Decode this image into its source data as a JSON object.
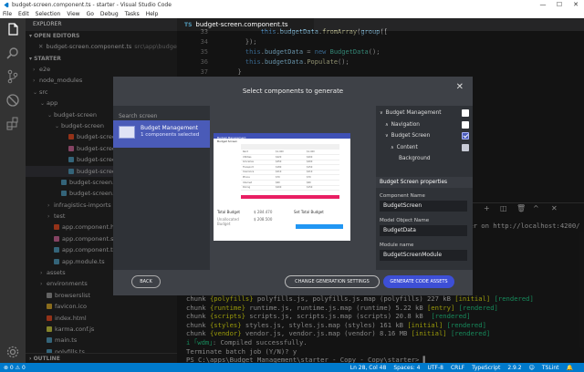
{
  "window": {
    "title": "budget-screen.component.ts - starter - Visual Studio Code",
    "minimize": "—",
    "maximize": "☐",
    "close": "✕"
  },
  "menu": [
    "File",
    "Edit",
    "Selection",
    "View",
    "Go",
    "Debug",
    "Tasks",
    "Help"
  ],
  "sidebar": {
    "header": "EXPLORER",
    "open_editors_title": "OPEN EDITORS",
    "open_editor": {
      "name": "budget-screen.component.ts",
      "path": "src\\app\\budget-sc..."
    },
    "project_title": "STARTER",
    "tree": [
      {
        "label": "e2e",
        "indent": 1,
        "kind": "folder"
      },
      {
        "label": "node_modules",
        "indent": 1,
        "kind": "folder"
      },
      {
        "label": "src",
        "indent": 1,
        "kind": "folder-open"
      },
      {
        "label": "app",
        "indent": 2,
        "kind": "folder-open"
      },
      {
        "label": "budget-screen",
        "indent": 3,
        "kind": "folder-open"
      },
      {
        "label": "budget-screen",
        "indent": 4,
        "kind": "folder-open"
      },
      {
        "label": "budget-screen.com",
        "indent": 5,
        "kind": "html"
      },
      {
        "label": "budget-screen.com",
        "indent": 5,
        "kind": "css"
      },
      {
        "label": "budget-screen.com",
        "indent": 5,
        "kind": "ts"
      },
      {
        "label": "budget-screen.com",
        "indent": 5,
        "kind": "ts",
        "selected": true
      },
      {
        "label": "budget-screen.modul",
        "indent": 4,
        "kind": "ts"
      },
      {
        "label": "budget-screen.modul",
        "indent": 4,
        "kind": "ts"
      },
      {
        "label": "infragistics-imports",
        "indent": 3,
        "kind": "folder"
      },
      {
        "label": "test",
        "indent": 3,
        "kind": "folder"
      },
      {
        "label": "app.component.html",
        "indent": 3,
        "kind": "html"
      },
      {
        "label": "app.component.scss",
        "indent": 3,
        "kind": "css"
      },
      {
        "label": "app.component.ts",
        "indent": 3,
        "kind": "ts"
      },
      {
        "label": "app.module.ts",
        "indent": 3,
        "kind": "ts"
      },
      {
        "label": "assets",
        "indent": 2,
        "kind": "folder"
      },
      {
        "label": "environments",
        "indent": 2,
        "kind": "folder"
      },
      {
        "label": "browserslist",
        "indent": 2,
        "kind": "file"
      },
      {
        "label": "favicon.ico",
        "indent": 2,
        "kind": "ico"
      },
      {
        "label": "index.html",
        "indent": 2,
        "kind": "html"
      },
      {
        "label": "karma.conf.js",
        "indent": 2,
        "kind": "js"
      },
      {
        "label": "main.ts",
        "indent": 2,
        "kind": "ts"
      },
      {
        "label": "polyfills.ts",
        "indent": 2,
        "kind": "ts"
      },
      {
        "label": "styles.scss",
        "indent": 2,
        "kind": "css"
      },
      {
        "label": "test.ts",
        "indent": 2,
        "kind": "ts"
      }
    ],
    "outline": "OUTLINE"
  },
  "editor": {
    "tab_label": "budget-screen.component.ts",
    "tab_badge": "TS",
    "lines": [
      {
        "n": "33",
        "html": "        <span class='k'>this</span>.<span class='p'>budgetData</span>.<span class='f'>fromArray</span>(<span class='p'>group</span>(["
      },
      {
        "n": "34",
        "html": "    <span class='w'>});</span>"
      },
      {
        "n": "35",
        "html": "    <span class='k'>this</span>.<span class='p'>budgetData</span> = <span class='k'>new</span> <span class='c'>BudgetData</span>();"
      },
      {
        "n": "36",
        "html": "    <span class='k'>this</span>.<span class='p'>budgetData</span>.<span class='f'>Populate</span>();"
      },
      {
        "n": "37",
        "html": "  <span class='w'>}</span>"
      },
      {
        "n": "38",
        "html": "<span class='w'>}</span>"
      }
    ]
  },
  "terminal": {
    "right_text": "ser on http://localhost:4200/",
    "lines": [
      {
        "html": "chunk <span class='y'>{polyfills}</span> polyfills.js, polyfills.js.map (polyfills) 227 kB <span class='y'>[initial]</span> <span class='g'>[rendered]</span>"
      },
      {
        "html": "chunk <span class='y'>{runtime}</span> runtime.js, runtime.js.map (runtime) 5.22 kB <span class='y'>[entry]</span> <span class='g'>[rendered]</span>"
      },
      {
        "html": "chunk <span class='y'>{scripts}</span> scripts.js, scripts.js.map (scripts) 20.8 kB  <span class='g'>[rendered]</span>"
      },
      {
        "html": "chunk <span class='y'>{styles}</span> styles.js, styles.js.map (styles) 161 kB <span class='y'>[initial]</span> <span class='g'>[rendered]</span>"
      },
      {
        "html": "chunk <span class='y'>{vendor}</span> vendor.js, vendor.js.map (vendor) 8.16 MB <span class='y'>[initial]</span> <span class='g'>[rendered]</span>"
      },
      {
        "html": "<span class='g'>i ｢wdm｣</span>: Compiled successfully."
      },
      {
        "html": "Terminate batch job (Y/N)? y"
      },
      {
        "html": "PS C:\\apps\\Budget Management\\starter - Copy - Copy\\starter&gt; ▌"
      }
    ]
  },
  "statusbar": {
    "left": [
      "⊗ 0  ⚠ 0"
    ],
    "right": [
      "Ln 28, Col 48",
      "Spaces: 4",
      "UTF-8",
      "CRLF",
      "TypeScript",
      "2.9.2",
      "☺",
      "TSLint",
      "🔔"
    ]
  },
  "modal": {
    "title": "Select components to generate",
    "close": "✕",
    "search_placeholder": "Search screen",
    "template": {
      "name": "Budget Management",
      "count": "1 components selected"
    },
    "preview": {
      "app_bar": "Budget Management",
      "heading": "Budget Screen",
      "grid_rows": [
        [
          "Rent",
          "$1,400",
          "$1,400"
        ],
        [
          "Utilities",
          "$220",
          "$200"
        ],
        [
          "Groceries",
          "$450",
          "$400"
        ],
        [
          "Transport",
          "$180",
          "$150"
        ],
        [
          "Insurance",
          "$210",
          "$210"
        ],
        [
          "Phone",
          "$70",
          "$70"
        ],
        [
          "Internet",
          "$60",
          "$60"
        ],
        [
          "Dining",
          "$200",
          "$150"
        ]
      ],
      "totals_left_label": "Total Budget",
      "totals_left_value": "$ 284.470",
      "unallocated_label": "Unallocated Budget",
      "unallocated_value": "$ 208.500",
      "totals_right_label": "Set Total Budget"
    },
    "tree": [
      {
        "label": "Budget Management",
        "indent": 0,
        "arrow": "∨",
        "check": "white"
      },
      {
        "label": "Navigation",
        "indent": 1,
        "arrow": "∧",
        "check": "white"
      },
      {
        "label": "Budget Screen",
        "indent": 1,
        "arrow": "∨",
        "check": "on"
      },
      {
        "label": "Content",
        "indent": 2,
        "arrow": "∧",
        "check": "soft"
      },
      {
        "label": "Background",
        "indent": 3,
        "arrow": "",
        "check": "none"
      }
    ],
    "props_title": "Budget Screen properties",
    "fields": [
      {
        "label": "Component Name",
        "value": "BudgetScreen"
      },
      {
        "label": "Model Object Name",
        "value": "BudgetData"
      },
      {
        "label": "Module name",
        "value": "BudgetScreenModule"
      }
    ],
    "buttons": {
      "back": "BACK",
      "settings": "CHANGE GENERATION SETTINGS",
      "generate": "GENERATE CODE ASSETS"
    }
  }
}
